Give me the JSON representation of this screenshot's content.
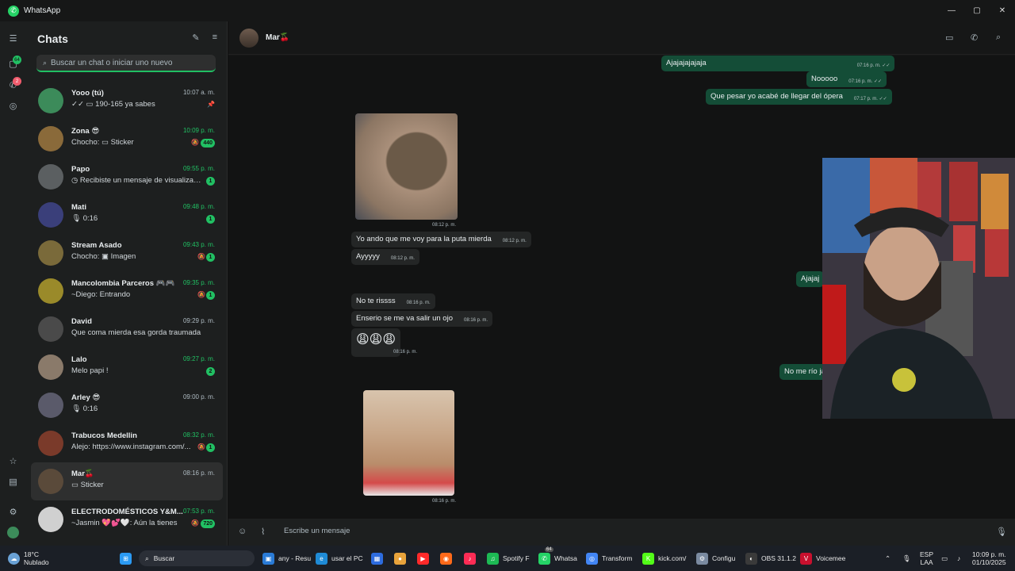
{
  "window": {
    "title": "WhatsApp",
    "minimize": "—",
    "maximize": "▢",
    "close": "✕"
  },
  "rail": {
    "chats_badge": "64",
    "calls_badge": "2"
  },
  "sidebar": {
    "title": "Chats",
    "search_placeholder": "Buscar un chat o iniciar uno nuevo",
    "chats": [
      {
        "name": "Yooo (tú)",
        "time": "10:07 a. m.",
        "preview": "✓✓ ▭ 190-165 ya sabes",
        "unread": "",
        "pinned": true,
        "muted": false,
        "time_unread": false,
        "avatar_color": "#3c8b5a"
      },
      {
        "name": "Zona 😎",
        "time": "10:09 p. m.",
        "preview": "Chocho: ▭ Sticker",
        "unread": "440",
        "pinned": false,
        "muted": true,
        "time_unread": true,
        "avatar_color": "#8a6a3a"
      },
      {
        "name": "Papo",
        "time": "09:55 p. m.",
        "preview": "◷ Recibiste un mensaje de visualizaci...",
        "unread": "1",
        "pinned": false,
        "muted": false,
        "time_unread": true,
        "avatar_color": "#5b5f61"
      },
      {
        "name": "Mati",
        "time": "09:48 p. m.",
        "preview": "🎙 0:16",
        "unread": "1",
        "pinned": false,
        "muted": false,
        "time_unread": true,
        "avatar_color": "#3a3f7a"
      },
      {
        "name": "Stream Asado",
        "time": "09:43 p. m.",
        "preview": "Chocho: ▣ Imagen",
        "unread": "1",
        "pinned": false,
        "muted": true,
        "time_unread": true,
        "avatar_color": "#7a6a3a"
      },
      {
        "name": "Mancolombia Parceros 🎮🎮",
        "time": "09:35 p. m.",
        "preview": "~Diego: Entrando",
        "unread": "1",
        "pinned": false,
        "muted": true,
        "time_unread": true,
        "avatar_color": "#9a8a2a"
      },
      {
        "name": "David",
        "time": "09:29 p. m.",
        "preview": "Que coma mierda esa gorda  traumada",
        "unread": "",
        "pinned": false,
        "muted": false,
        "time_unread": false,
        "avatar_color": "#4a4a4a"
      },
      {
        "name": "Lalo",
        "time": "09:27 p. m.",
        "preview": "Melo papi !",
        "unread": "2",
        "pinned": false,
        "muted": false,
        "time_unread": true,
        "avatar_color": "#8a7a6a"
      },
      {
        "name": "Arley 😎",
        "time": "09:00 p. m.",
        "preview": "🎙 0:16",
        "unread": "",
        "pinned": false,
        "muted": false,
        "time_unread": false,
        "avatar_color": "#5a5a6a"
      },
      {
        "name": "Trabucos Medellin",
        "time": "08:32 p. m.",
        "preview": "Alejo: https://www.instagram.com/...",
        "unread": "1",
        "pinned": false,
        "muted": true,
        "time_unread": true,
        "avatar_color": "#7a3a2a"
      },
      {
        "name": "Mar🍒",
        "time": "08:16 p. m.",
        "preview": "▭ Sticker",
        "unread": "",
        "pinned": false,
        "muted": false,
        "time_unread": false,
        "avatar_color": "#5a4a3a"
      },
      {
        "name": "ELECTRODOMÉSTICOS Y&M...",
        "time": "07:53 p. m.",
        "preview": "~Jasmin 💖💕🤍: Aún la tienes",
        "unread": "720",
        "pinned": false,
        "muted": true,
        "time_unread": true,
        "avatar_color": "#d0d0d0"
      }
    ]
  },
  "conversation": {
    "contact_name": "Mar🍒",
    "composer_placeholder": "Escribe un mensaje",
    "messages": [
      {
        "dir": "out",
        "text": "Ajajajajajaja",
        "time": "07:16 p. m. ✓✓"
      },
      {
        "dir": "out",
        "text": "Nooooo",
        "time": "07:16 p. m. ✓✓"
      },
      {
        "dir": "out",
        "text": "Que pesar yo acabé de llegar del ópera",
        "time": "07:17 p. m. ✓✓"
      },
      {
        "dir": "in",
        "text": "",
        "time": "08:12 p. m.",
        "media": "hedgehog"
      },
      {
        "dir": "in",
        "text": "Yo ando que me voy para la puta mierda",
        "time": "08:12 p. m."
      },
      {
        "dir": "in",
        "text": "Ayyyyy",
        "time": "08:12 p. m."
      },
      {
        "dir": "out",
        "text": "Ajajaj",
        "time": ""
      },
      {
        "dir": "in",
        "text": "No te rissss",
        "time": "08:16 p. m."
      },
      {
        "dir": "in",
        "text": "Enserio se me va salir un ojo",
        "time": "08:16 p. m."
      },
      {
        "dir": "in",
        "text": "😩😩😩",
        "time": "08:16 p. m."
      },
      {
        "dir": "out",
        "text": "No me río ja",
        "time": ""
      },
      {
        "dir": "in",
        "text": "",
        "time": "08:16 p. m.",
        "media": "child"
      }
    ]
  },
  "taskbar": {
    "weather_temp": "18°C",
    "weather_desc": "Nublado",
    "search_label": "Buscar",
    "items": [
      {
        "label": "any - Resu",
        "icon": "▣",
        "color": "#2a7bd6"
      },
      {
        "label": "usar el PC",
        "icon": "e",
        "color": "#1f8bd6"
      },
      {
        "label": "",
        "icon": "▦",
        "color": "#2d6cdf"
      },
      {
        "label": "",
        "icon": "●",
        "color": "#e8a33b"
      },
      {
        "label": "",
        "icon": "▶",
        "color": "#ff2a2a"
      },
      {
        "label": "",
        "icon": "◉",
        "color": "#ff6a1a"
      },
      {
        "label": "",
        "icon": "♪",
        "color": "#fe2c55"
      },
      {
        "label": "Spotify F",
        "icon": "♫",
        "color": "#1db954"
      },
      {
        "label": "Whatsa",
        "icon": "✆",
        "color": "#25d366",
        "badge": "64"
      },
      {
        "label": "Transform",
        "icon": "◎",
        "color": "#4285f4"
      },
      {
        "label": "kick.com/",
        "icon": "K",
        "color": "#53fc18"
      },
      {
        "label": "Configu",
        "icon": "⚙",
        "color": "#7a8aa0"
      },
      {
        "label": "OBS 31.1.2",
        "icon": "◐",
        "color": "#3a3a3a"
      },
      {
        "label": "Voicemee",
        "icon": "V",
        "color": "#c8102e"
      }
    ],
    "lang": "ESP",
    "lang_sub": "LAA",
    "clock_time": "10:09 p. m.",
    "clock_date": "01/10/2025"
  }
}
